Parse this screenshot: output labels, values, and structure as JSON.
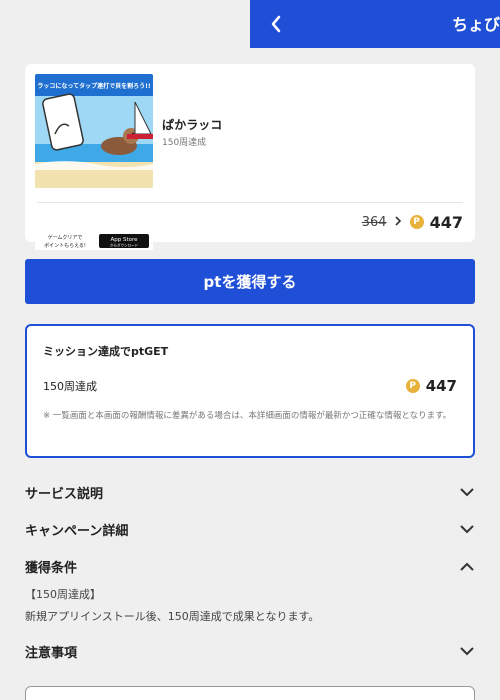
{
  "header": {
    "title": "ちょびリッチ"
  },
  "app": {
    "name": "ぱかラッコ",
    "subtitle": "150周達成",
    "banner_text_top": "ラッコになってタップ連打で貝を割ろう!!",
    "banner_text_bottom": "ゲームクリアで\nポイントもらえる!",
    "store_badge_small": "App Store",
    "store_badge_line2": "からダウンロード",
    "old_price": "364",
    "new_price": "447",
    "coin_symbol": "P"
  },
  "get_button": {
    "label": "ptを獲得する"
  },
  "mission": {
    "title": "ミッション達成でptGET",
    "item_label": "150周達成",
    "item_points": "447",
    "note": "※ 一覧画面と本画面の報酬情報に差異がある場合は、本詳細画面の情報が最新かつ正確な情報となります。"
  },
  "sections": [
    {
      "title": "サービス説明",
      "expanded": false
    },
    {
      "title": "キャンペーン詳細",
      "expanded": false
    },
    {
      "title": "獲得条件",
      "expanded": true
    },
    {
      "title": "注意事項",
      "expanded": false
    }
  ],
  "conditions": {
    "line1": "【150周達成】",
    "line2": "新規アプリインストール後、150周達成で成果となります。"
  },
  "colors": {
    "brand": "#1e4fd6",
    "coin": "#e8b23a"
  }
}
